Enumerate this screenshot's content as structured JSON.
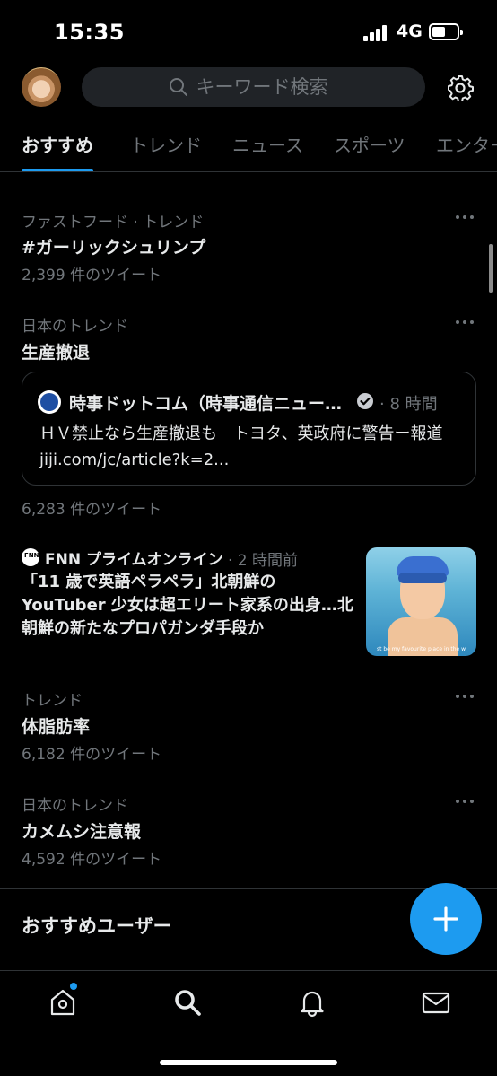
{
  "status_bar": {
    "time": "15:35",
    "network": "4G",
    "battery_percent": 55
  },
  "header": {
    "search_placeholder": "キーワード検索",
    "icons": [
      "search-icon",
      "gear-icon"
    ]
  },
  "tabs": [
    {
      "label": "おすすめ",
      "active": true
    },
    {
      "label": "トレンド",
      "active": false
    },
    {
      "label": "ニュース",
      "active": false
    },
    {
      "label": "スポーツ",
      "active": false
    },
    {
      "label": "エンター",
      "active": false
    }
  ],
  "trends": [
    {
      "meta": "ファストフード · トレンド",
      "title": "#ガーリックシュリンプ",
      "count": "2,399 件のツイート"
    },
    {
      "meta": "日本のトレンド",
      "title": "生産撤退",
      "count": "6,283 件のツイート"
    },
    {
      "meta": "トレンド",
      "title": "体脂肪率",
      "count": "6,182 件のツイート"
    },
    {
      "meta": "日本のトレンド",
      "title": "カメムシ注意報",
      "count": "4,592 件のツイート"
    }
  ],
  "news_card": {
    "source": "時事ドットコム（時事通信ニュー…",
    "time": "· 8 時間",
    "body": "ＨＶ禁止なら生産撤退も　トヨタ、英政府に警告ー報道 jiji.com/jc/article?k=2..."
  },
  "story": {
    "source": "FNN プライムオンライン",
    "time": "· 2 時間前",
    "title": "「11 歳で英語ペラペラ」北朝鮮の YouTuber 少女は超エリート家系の出身…北朝鮮の新たなプロパガンダ手段か",
    "thumbnail_caption": "st be my favourite place in the w"
  },
  "suggested_users": {
    "title": "おすすめユーザー"
  },
  "bottom_nav": {
    "items": [
      "home-icon",
      "search-icon",
      "bell-icon",
      "mail-icon"
    ],
    "accent": "#1d9bf0"
  },
  "colors": {
    "background": "#000000",
    "accent": "#1d9bf0",
    "secondary_text": "#71767b",
    "primary_text": "#e7e9ea"
  }
}
